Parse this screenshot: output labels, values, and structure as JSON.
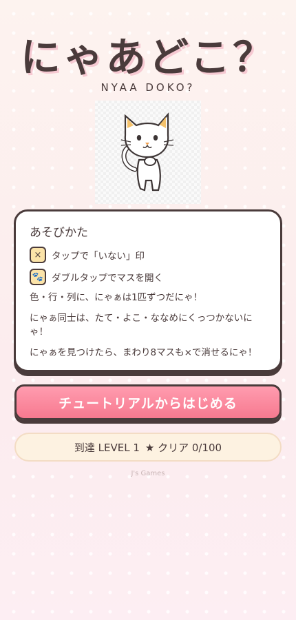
{
  "header": {
    "title": "にゃあどこ？",
    "subtitle": "NYAA DOKO?"
  },
  "how_to_play": {
    "title": "あそびかた",
    "items": [
      {
        "icon": "x-mark-icon",
        "icon_glyph": "×",
        "label": "タップで「いない」印"
      },
      {
        "icon": "paw-icon",
        "icon_glyph": "🐾",
        "label": "ダブルタップでマスを開く"
      }
    ],
    "rules": [
      "色・行・列に、にゃぁは1匹ずつだにゃ！",
      "にゃぁ同士は、たて・よこ・ななめにくっつかないにゃ！",
      "にゃぁを見つけたら、まわり8マスも×で消せるにゃ！"
    ]
  },
  "start_button": {
    "label": "チュートリアルからはじめる"
  },
  "progress": {
    "level_label": "到達 LEVEL 1",
    "clear_label": "★ クリア 0/100"
  },
  "footer": {
    "credit": "J's Games"
  },
  "colors": {
    "text": "#4a3b3b",
    "accent_pink": "#f7798f",
    "badge_yellow": "#fbe3a8",
    "title_shadow": "#f6c9d2"
  }
}
